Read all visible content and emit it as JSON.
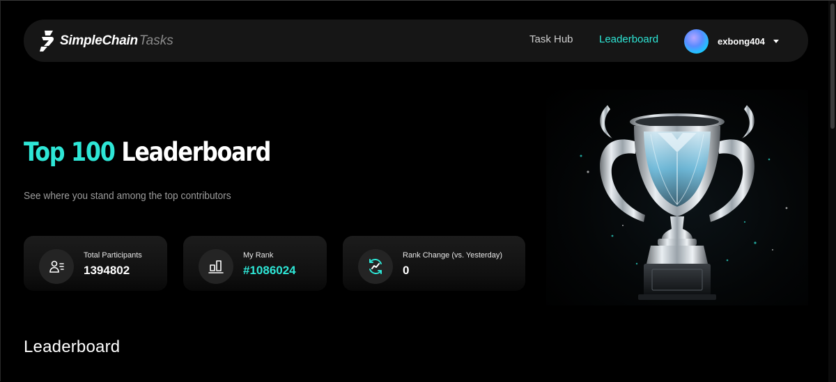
{
  "nav": {
    "brand_main": "SimpleChain",
    "brand_sub": "Tasks",
    "links": [
      {
        "label": "Task Hub",
        "active": false
      },
      {
        "label": "Leaderboard",
        "active": true
      }
    ],
    "user": {
      "name": "exbong404"
    }
  },
  "hero": {
    "title_accent": "Top 100",
    "title_rest": "Leaderboard",
    "subtitle": "See where you stand among the top contributors"
  },
  "stats": [
    {
      "label": "Total Participants",
      "value": "1394802",
      "icon": "participants-icon"
    },
    {
      "label": "My Rank",
      "value": "#1086024",
      "icon": "rank-chart-icon"
    },
    {
      "label": "Rank Change (vs. Yesterday)",
      "value": "0",
      "icon": "rank-change-icon"
    }
  ],
  "section": {
    "title": "Leaderboard"
  },
  "colors": {
    "accent": "#2ee6d6",
    "background": "#000000",
    "card": "#161616"
  }
}
